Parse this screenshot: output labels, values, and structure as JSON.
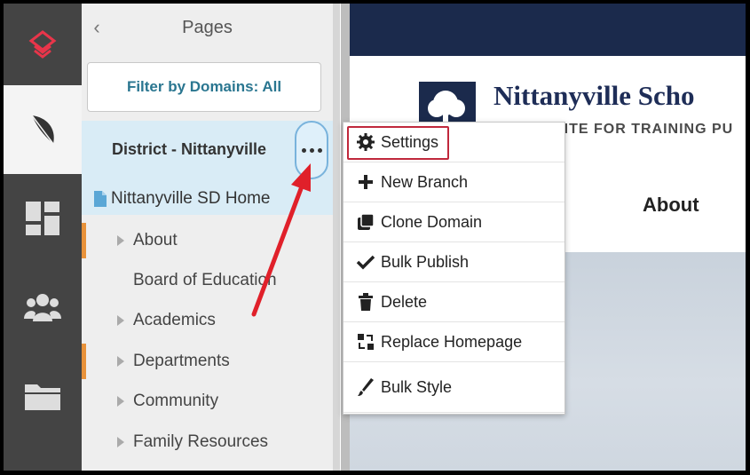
{
  "sidebar": {
    "title": "Pages",
    "collapse_glyph": "‹",
    "filter_label": "Filter by Domains: All",
    "domain_name": "District - Nittanyville",
    "home_page": "Nittanyville SD Home",
    "tree": [
      {
        "label": "About",
        "has_children": true,
        "marker": true
      },
      {
        "label": "Board of Education",
        "has_children": false,
        "marker": false
      },
      {
        "label": "Academics",
        "has_children": true,
        "marker": false
      },
      {
        "label": "Departments",
        "has_children": true,
        "marker": true
      },
      {
        "label": "Community",
        "has_children": true,
        "marker": false
      },
      {
        "label": "Family Resources",
        "has_children": true,
        "marker": false
      }
    ]
  },
  "rail": {
    "items": [
      "logo-icon",
      "feather-icon",
      "dashboard-icon",
      "users-icon",
      "folder-icon"
    ]
  },
  "preview": {
    "site_name": "Nittanyville Scho",
    "tagline": "SITE FOR TRAINING PU",
    "nav_label": "About"
  },
  "context_menu": {
    "items": [
      {
        "label": "Settings",
        "icon": "gear-icon",
        "highlighted": true
      },
      {
        "label": "New Branch",
        "icon": "plus-icon"
      },
      {
        "label": "Clone Domain",
        "icon": "clone-icon"
      },
      {
        "label": "Bulk Publish",
        "icon": "check-icon"
      },
      {
        "label": "Delete",
        "icon": "trash-icon"
      },
      {
        "label": "Replace Homepage",
        "icon": "replace-icon"
      },
      {
        "label": "Bulk Style",
        "icon": "brush-icon"
      }
    ]
  },
  "colors": {
    "rail": "#444444",
    "topbar": "#1b2a4c",
    "filter_text": "#2a7690",
    "selection": "#d9ecf6",
    "marker": "#e8923a",
    "highlight_box": "#c0283c",
    "arrow": "#e0202a"
  }
}
